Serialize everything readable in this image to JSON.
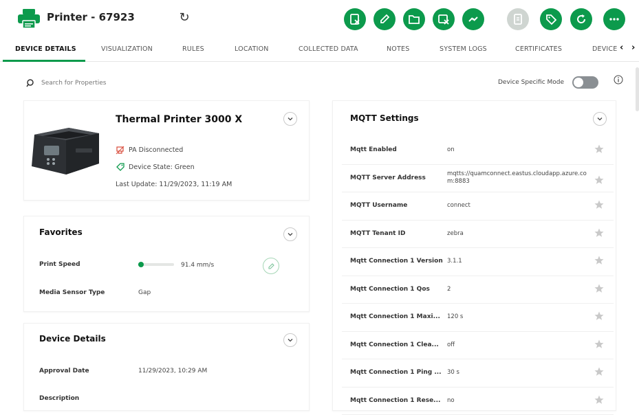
{
  "header": {
    "title": "Printer - 67923",
    "actions": [
      {
        "icon": "clear-alerts-icon",
        "disabled": false
      },
      {
        "icon": "pencil-icon",
        "disabled": false
      },
      {
        "icon": "folder-icon",
        "disabled": false
      },
      {
        "icon": "delete-device-icon",
        "disabled": false
      },
      {
        "icon": "link-icon",
        "disabled": false
      },
      {
        "icon": "document-icon",
        "disabled": true
      },
      {
        "icon": "tag-icon",
        "disabled": false
      },
      {
        "icon": "refresh-icon",
        "disabled": false
      },
      {
        "icon": "more-icon",
        "disabled": false
      }
    ]
  },
  "tabs": [
    {
      "label": "DEVICE DETAILS",
      "active": true
    },
    {
      "label": "VISUALIZATION"
    },
    {
      "label": "RULES"
    },
    {
      "label": "LOCATION"
    },
    {
      "label": "COLLECTED DATA"
    },
    {
      "label": "NOTES"
    },
    {
      "label": "SYSTEM LOGS"
    },
    {
      "label": "CERTIFICATES"
    },
    {
      "label": "DEVICE"
    }
  ],
  "search": {
    "placeholder": "Search for Properties"
  },
  "device_mode": {
    "label": "Device Specific Mode",
    "enabled": false
  },
  "device": {
    "name": "Thermal Printer 3000 X",
    "pa_status": "PA Disconnected",
    "device_state": "Device State: Green",
    "last_update": "Last Update: 11/29/2023, 11:19 AM"
  },
  "favorites": {
    "title": "Favorites",
    "print_speed_label": "Print Speed",
    "print_speed_value": "91.4 mm/s",
    "print_speed_level": 0.12,
    "media_sensor_label": "Media Sensor Type",
    "media_sensor_value": "Gap"
  },
  "device_details": {
    "title": "Device Details",
    "approval_label": "Approval Date",
    "approval_value": "11/29/2023, 10:29 AM",
    "description_label": "Description"
  },
  "mqtt": {
    "title": "MQTT Settings",
    "rows": [
      {
        "label": "Mqtt Enabled",
        "value": "on"
      },
      {
        "label": "MQTT Server Address",
        "value": "mqtts://quamconnect.eastus.cloudapp.azure.com:8883"
      },
      {
        "label": "MQTT Username",
        "value": "connect"
      },
      {
        "label": "MQTT Tenant ID",
        "value": "zebra"
      },
      {
        "label": "Mqtt Connection 1 Version",
        "value": "3.1.1"
      },
      {
        "label": "Mqtt Connection 1 Qos",
        "value": "2"
      },
      {
        "label": "Mqtt Connection 1 Maxi...",
        "value": "120 s"
      },
      {
        "label": "Mqtt Connection 1 Clea...",
        "value": "off"
      },
      {
        "label": "Mqtt Connection 1 Ping ...",
        "value": "30 s"
      },
      {
        "label": "Mqtt Connection 1 Rese...",
        "value": "no"
      }
    ]
  },
  "colors": {
    "accent": "#0c9a4c",
    "disabled": "#cfd5d1"
  }
}
